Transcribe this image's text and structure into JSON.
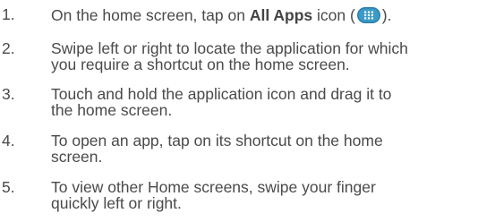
{
  "steps": [
    {
      "number": "1.",
      "text_before": "On the home screen, tap on ",
      "bold": "All Apps",
      "text_after": " icon (",
      "icon": "all-apps-icon",
      "text_end": ")."
    },
    {
      "number": "2.",
      "line1": "Swipe left or right to locate the application for which",
      "line2": "you require a shortcut on the home screen."
    },
    {
      "number": "3.",
      "line1": "Touch and hold the application icon and drag it to",
      "line2": "the home screen."
    },
    {
      "number": "4.",
      "line1": "To open an app, tap on its shortcut on the home",
      "line2": "screen."
    },
    {
      "number": "5.",
      "line1": "To view other Home screens, swipe your finger",
      "line2": "quickly left or right."
    }
  ],
  "colors": {
    "text": "#4a4a4a",
    "icon_fill": "#2a7ea8",
    "icon_dots": "#ffffff"
  }
}
